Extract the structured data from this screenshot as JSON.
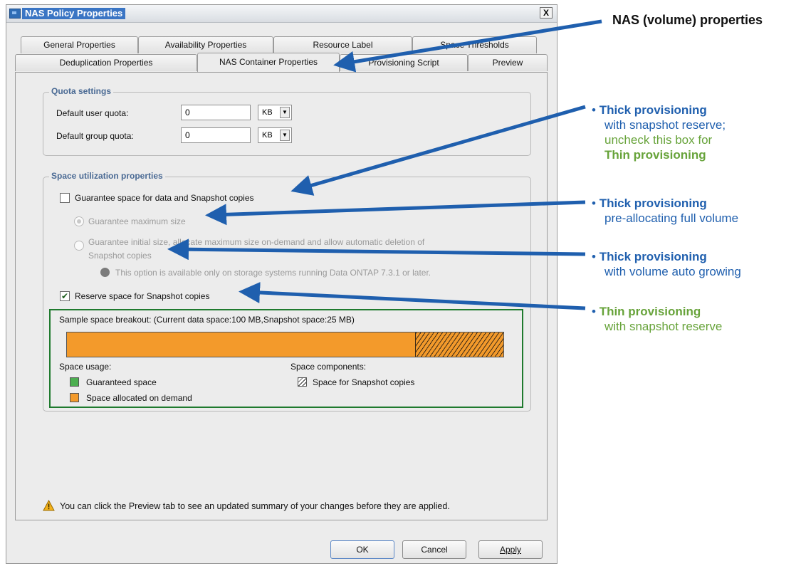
{
  "window": {
    "title": "NAS Policy Properties",
    "close_glyph": "X"
  },
  "tabs": {
    "row1": [
      "General Properties",
      "Availability Properties",
      "Resource Label",
      "Space Thresholds"
    ],
    "row2": [
      "Deduplication Properties",
      "NAS Container Properties",
      "Provisioning Script",
      "Preview"
    ],
    "active": "NAS Container Properties"
  },
  "quota": {
    "group_label": "Quota settings",
    "user_label": "Default user quota:",
    "user_value": "0",
    "user_unit": "KB",
    "group_quota_label": "Default group quota:",
    "group_value": "0",
    "group_unit": "KB"
  },
  "space": {
    "group_label": "Space utilization properties",
    "guarantee_checkbox_label": "Guarantee space for data and Snapshot copies",
    "guarantee_checked": false,
    "radio_max_label": "Guarantee maximum size",
    "radio_initial_line1": "Guarantee initial size, allocate maximum size on-demand and allow automatic deletion of",
    "radio_initial_line2": "Snapshot copies",
    "info_note": "This option is available only on storage systems running Data ONTAP 7.3.1 or later.",
    "reserve_checkbox_label": "Reserve space for Snapshot copies",
    "reserve_checked": true,
    "check_glyph": "✔"
  },
  "breakout": {
    "title": "Sample space breakout: (Current data space:100 MB,Snapshot space:25 MB)",
    "data_space_mb": 100,
    "snapshot_space_mb": 25,
    "usage_heading": "Space usage:",
    "components_heading": "Space components:",
    "legend_guaranteed": "Guaranteed space",
    "legend_on_demand": "Space allocated on demand",
    "legend_snapshot": "Space for Snapshot copies",
    "colors": {
      "guaranteed": "#4caf50",
      "on_demand": "#f39a2b",
      "border": "#1f7a2e"
    }
  },
  "footer": {
    "warning_text": "You can click the Preview tab to see an updated summary of your changes before they are applied.",
    "ok_label": "OK",
    "cancel_label": "Cancel",
    "apply_label": "Apply"
  },
  "annotations": {
    "header": "NAS (volume) properties",
    "bullet": "•",
    "a1": {
      "title": "Thick provisioning",
      "line2": "with snapshot reserve;",
      "line3": "uncheck this box for",
      "line4": "Thin provisioning"
    },
    "a2": {
      "title": "Thick provisioning",
      "line2": "pre-allocating full volume"
    },
    "a3": {
      "title": "Thick provisioning",
      "line2": "with volume auto growing"
    },
    "a4": {
      "title": "Thin provisioning",
      "line2": "with snapshot reserve"
    },
    "colors": {
      "blue": "#1f5fae",
      "green": "#67a33a",
      "arrow": "#1f5fae"
    }
  }
}
